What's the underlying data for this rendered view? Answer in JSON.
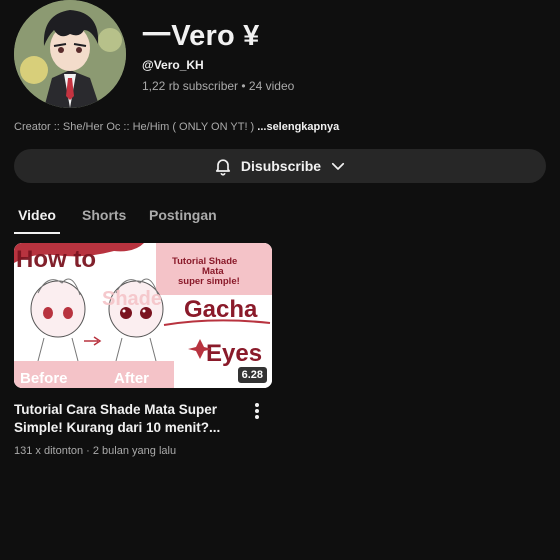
{
  "channel": {
    "name": "一Vero ¥",
    "handle": "@Vero_KH",
    "stats": "1,22 rb subscriber • 24 video",
    "description": "Creator :: She/Her Oc :: He/Him ( ONLY ON YT! ) ",
    "more_label": "...selengkapnya"
  },
  "subscribe_button": {
    "label": "Disubscribe",
    "icon": "bell-icon",
    "chevron": "chevron-down-icon"
  },
  "tabs": [
    {
      "label": "Video",
      "active": true
    },
    {
      "label": "Shorts",
      "active": false
    },
    {
      "label": "Postingan",
      "active": false
    }
  ],
  "video": {
    "title": "Tutorial Cara Shade Mata Super Simple! Kurang dari 10 menit?...",
    "meta": "131 x ditonton · 2 bulan yang lalu",
    "duration": "6.28",
    "thumbnail_text": {
      "how_to": "How to",
      "shade": "Shade",
      "gacha": "Gacha",
      "eyes": "Eyes",
      "tutorial": "Tutorial Shade Mata super simple!",
      "before": "Before",
      "after": "After"
    }
  },
  "colors": {
    "background": "#0f0f0f",
    "button": "#272727",
    "accent": "#b8333f",
    "thumb_pink": "#f4c3c8"
  }
}
